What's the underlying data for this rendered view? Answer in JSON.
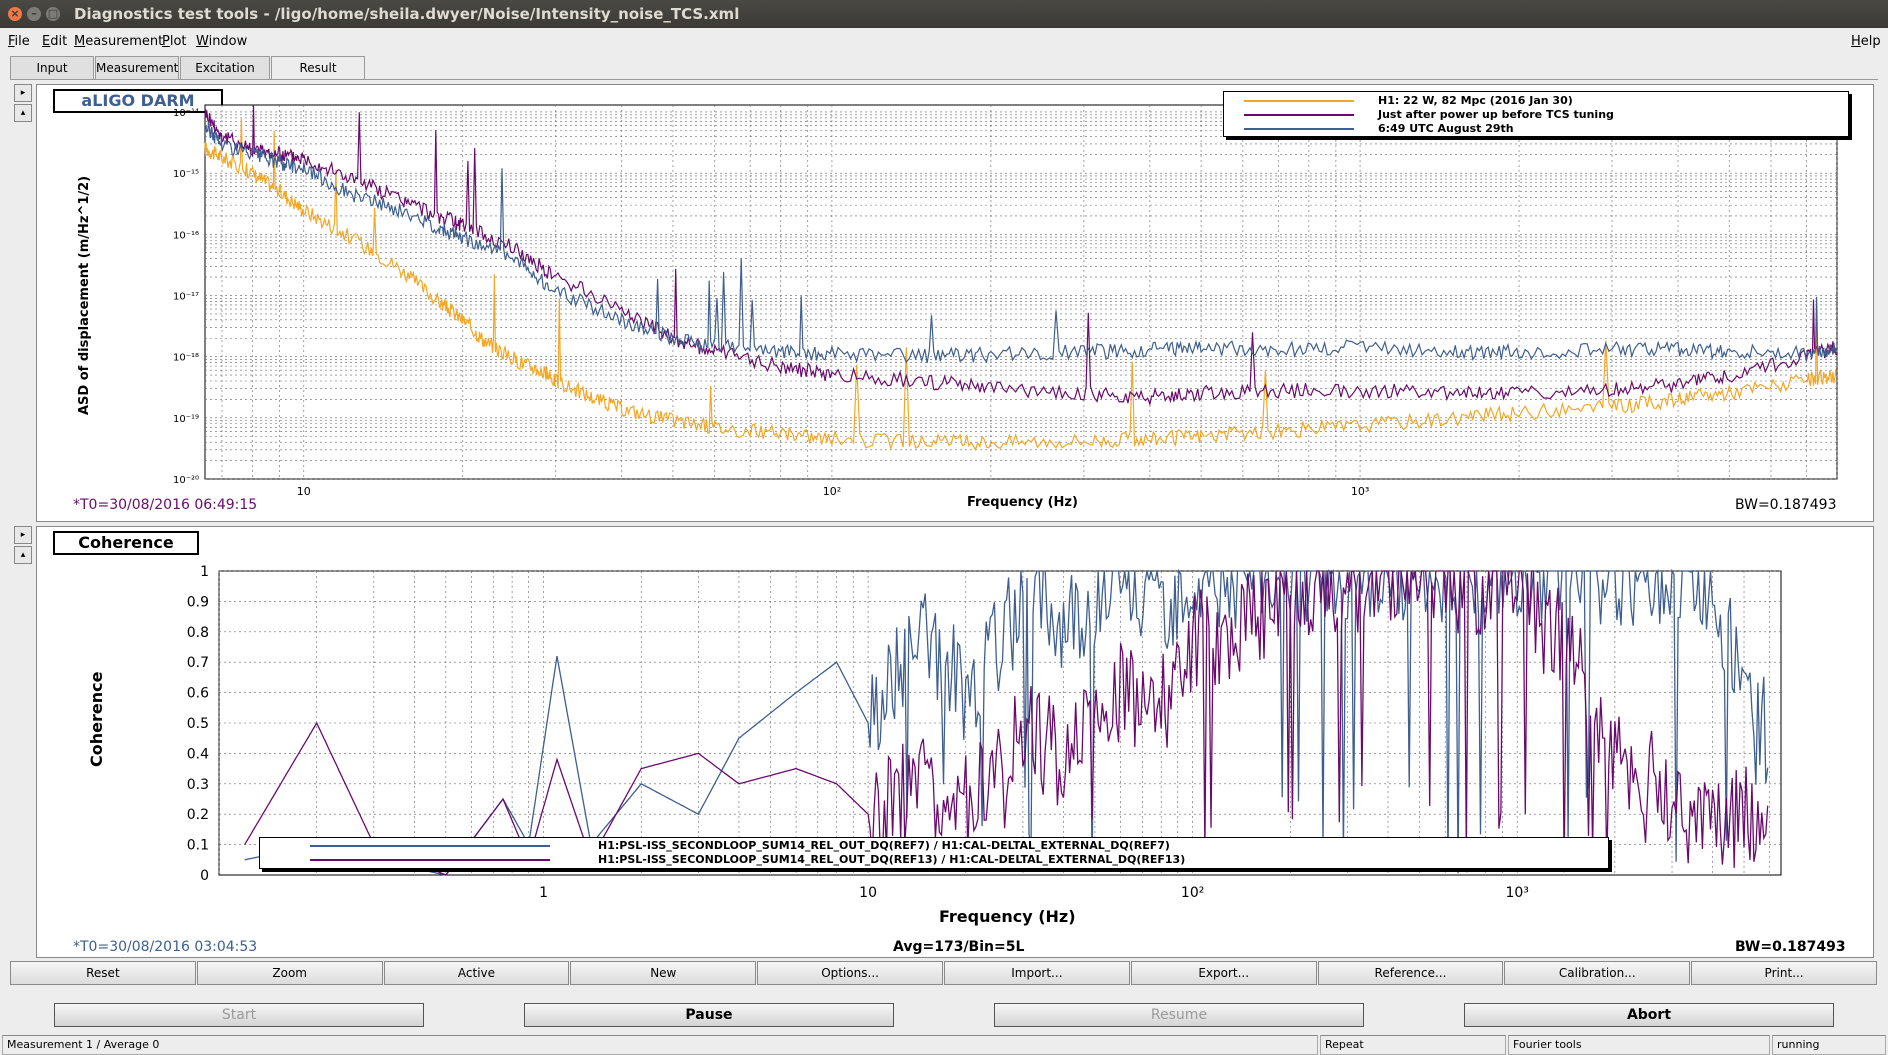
{
  "window": {
    "title": "Diagnostics test tools - /ligo/home/sheila.dwyer/Noise/Intensity_noise_TCS.xml",
    "buttons": [
      "×",
      "–",
      "□"
    ]
  },
  "menu": {
    "items": [
      "File",
      "Edit",
      "Measurement",
      "Plot",
      "Window"
    ],
    "help": "Help"
  },
  "tabs": [
    "Input",
    "Measurement",
    "Excitation",
    "Result"
  ],
  "active_tab": "Result",
  "side_buttons": [
    "▸",
    "▴"
  ],
  "top_plot": {
    "title": "aLIGO DARM",
    "t0": "*T0=30/08/2016 06:49:15",
    "bw": "BW=0.187493",
    "xlabel": "Frequency (Hz)",
    "ylabel": "ASD of displacement (m/Hz^1/2)",
    "xticks": [
      "10",
      "10²",
      "10³"
    ],
    "yticks": [
      "10⁻¹⁴",
      "10⁻¹⁵",
      "10⁻¹⁶",
      "10⁻¹⁷",
      "10⁻¹⁸",
      "10⁻¹⁹",
      "10⁻²⁰"
    ],
    "legend": [
      {
        "label": "H1: 22 W, 82 Mpc (2016 Jan 30)",
        "color": "#f5a623"
      },
      {
        "label": "Just after power up before TCS tuning",
        "color": "#6b0a6e"
      },
      {
        "label": "6:49 UTC August 29th",
        "color": "#3e5f8f"
      }
    ]
  },
  "bottom_plot": {
    "title": "Coherence",
    "t0": "*T0=30/08/2016 03:04:53",
    "avg": "Avg=173/Bin=5L",
    "bw": "BW=0.187493",
    "xlabel": "Frequency (Hz)",
    "ylabel": "Coherence",
    "xticks": [
      "1",
      "10",
      "10²",
      "10³"
    ],
    "yticks": [
      "1",
      "0.9",
      "0.8",
      "0.7",
      "0.6",
      "0.5",
      "0.4",
      "0.3",
      "0.2",
      "0.1",
      "0"
    ],
    "legend": [
      {
        "label": "H1:PSL-ISS_SECONDLOOP_SUM14_REL_OUT_DQ(REF7) / H1:CAL-DELTAL_EXTERNAL_DQ(REF7)",
        "color": "#3e5f8f"
      },
      {
        "label": "H1:PSL-ISS_SECONDLOOP_SUM14_REL_OUT_DQ(REF13) / H1:CAL-DELTAL_EXTERNAL_DQ(REF13)",
        "color": "#6b0a6e"
      }
    ]
  },
  "toolbar": [
    "Reset",
    "Zoom",
    "Active",
    "New",
    "Options...",
    "Import...",
    "Export...",
    "Reference...",
    "Calibration...",
    "Print..."
  ],
  "controls": [
    {
      "label": "Start",
      "enabled": false
    },
    {
      "label": "Pause",
      "enabled": true
    },
    {
      "label": "Resume",
      "enabled": false
    },
    {
      "label": "Abort",
      "enabled": true
    }
  ],
  "status": {
    "measurement": "Measurement 1 / Average 0",
    "repeat": "Repeat",
    "tools": "Fourier tools",
    "state": "running"
  },
  "chart_data": [
    {
      "type": "line",
      "title": "aLIGO DARM",
      "xlabel": "Frequency (Hz)",
      "ylabel": "ASD of displacement (m/Hz^1/2)",
      "xscale": "log",
      "yscale": "log",
      "xlim": [
        6.5,
        8000
      ],
      "ylim": [
        1e-20,
        1.3e-14
      ],
      "grid": true,
      "legend": "top-right",
      "series": [
        {
          "name": "H1: 22 W, 82 Mpc (2016 Jan 30)",
          "color": "#f5a623",
          "x": [
            6.5,
            7,
            8,
            9,
            10,
            12,
            15,
            18,
            20,
            22,
            25,
            28,
            30,
            35,
            40,
            50,
            60,
            80,
            100,
            150,
            200,
            300,
            400,
            500,
            700,
            1000,
            1500,
            2000,
            3000,
            4000,
            5000,
            7000,
            8000
          ],
          "y": [
            2.5e-15,
            1.8e-15,
            1e-15,
            5e-16,
            2.5e-16,
            1e-16,
            3e-17,
            8e-18,
            4e-18,
            1.8e-18,
            9e-19,
            6e-19,
            4e-19,
            2.2e-19,
            1.4e-19,
            9e-20,
            7e-20,
            5.5e-20,
            4.5e-20,
            4e-20,
            4e-20,
            4.2e-20,
            4.5e-20,
            5e-20,
            6e-20,
            7.5e-20,
            1e-19,
            1.2e-19,
            1.5e-19,
            2e-19,
            2.6e-19,
            4e-19,
            5e-19
          ]
        },
        {
          "name": "Just after power up before TCS tuning",
          "color": "#6b0a6e",
          "x": [
            6.5,
            7,
            8,
            9,
            10,
            12,
            15,
            18,
            20,
            25,
            30,
            40,
            50,
            60,
            80,
            100,
            150,
            200,
            300,
            400,
            500,
            700,
            1000,
            1500,
            2000,
            3000,
            4000,
            5000,
            7000,
            8000
          ],
          "y": [
            1e-14,
            4e-15,
            2.5e-15,
            2e-15,
            1.8e-15,
            9e-16,
            4e-16,
            2e-16,
            1.4e-16,
            6e-17,
            2e-17,
            6e-18,
            2e-18,
            1.2e-18,
            7e-19,
            5e-19,
            4e-19,
            3e-19,
            2.5e-19,
            2.2e-19,
            2.5e-19,
            2.8e-19,
            2.8e-19,
            2.6e-19,
            2.6e-19,
            3e-19,
            3.5e-19,
            5e-19,
            1e-18,
            1.4e-18
          ]
        },
        {
          "name": "6:49 UTC August 29th",
          "color": "#3e5f8f",
          "x": [
            6.5,
            7,
            8,
            9,
            10,
            12,
            15,
            18,
            20,
            25,
            30,
            40,
            50,
            60,
            80,
            100,
            150,
            200,
            300,
            400,
            500,
            700,
            1000,
            1500,
            2000,
            3000,
            4000,
            5000,
            7000,
            8000
          ],
          "y": [
            6e-15,
            3e-15,
            2e-15,
            1.5e-15,
            1.2e-15,
            5e-16,
            2.5e-16,
            1.3e-16,
            9e-17,
            4e-17,
            1.2e-17,
            4e-18,
            2e-18,
            1.5e-18,
            1.2e-18,
            1.1e-18,
            1e-18,
            1.1e-18,
            1.2e-18,
            1.3e-18,
            1.4e-18,
            1.3e-18,
            1.5e-18,
            1.2e-18,
            1.2e-18,
            1.3e-18,
            1.3e-18,
            1.2e-18,
            1.1e-18,
            1.3e-18
          ]
        }
      ]
    },
    {
      "type": "line",
      "title": "Coherence",
      "xlabel": "Frequency (Hz)",
      "ylabel": "Coherence",
      "xscale": "log",
      "xlim": [
        0.1,
        6500
      ],
      "ylim": [
        0,
        1
      ],
      "grid": true,
      "legend": "bottom-center",
      "series": [
        {
          "name": "H1:PSL-ISS_SECONDLOOP_SUM14_REL_OUT_DQ(REF7) / H1:CAL-DELTAL_EXTERNAL_DQ(REF7)",
          "color": "#3e5f8f",
          "x": [
            0.12,
            0.2,
            0.3,
            0.5,
            0.75,
            0.9,
            1.1,
            1.4,
            2,
            3,
            4,
            6,
            8,
            10,
            15,
            20,
            30,
            40,
            60,
            80,
            100,
            150,
            200,
            300,
            500,
            1000,
            2000,
            3000,
            4000,
            5000,
            6000
          ],
          "y": [
            0.05,
            0.1,
            0.05,
            0.0,
            0.25,
            0.1,
            0.72,
            0.1,
            0.3,
            0.2,
            0.45,
            0.6,
            0.7,
            0.5,
            0.8,
            0.6,
            0.9,
            0.85,
            0.95,
            0.9,
            0.97,
            0.98,
            0.99,
            1.0,
            1.0,
            1.0,
            0.99,
            0.98,
            0.97,
            0.6,
            0.45
          ]
        },
        {
          "name": "H1:PSL-ISS_SECONDLOOP_SUM14_REL_OUT_DQ(REF13) / H1:CAL-DELTAL_EXTERNAL_DQ(REF13)",
          "color": "#6b0a6e",
          "x": [
            0.12,
            0.2,
            0.3,
            0.5,
            0.75,
            0.9,
            1.1,
            1.4,
            2,
            3,
            4,
            6,
            8,
            10,
            15,
            20,
            30,
            40,
            60,
            80,
            100,
            150,
            200,
            300,
            500,
            1000,
            1500,
            2000,
            3000,
            4000,
            5000,
            6000
          ],
          "y": [
            0.1,
            0.5,
            0.1,
            0.0,
            0.25,
            0.05,
            0.38,
            0.05,
            0.35,
            0.4,
            0.3,
            0.35,
            0.3,
            0.2,
            0.3,
            0.25,
            0.5,
            0.4,
            0.6,
            0.55,
            0.75,
            0.85,
            0.95,
            0.97,
            0.98,
            0.95,
            0.7,
            0.4,
            0.25,
            0.2,
            0.18,
            0.25
          ]
        }
      ]
    }
  ]
}
